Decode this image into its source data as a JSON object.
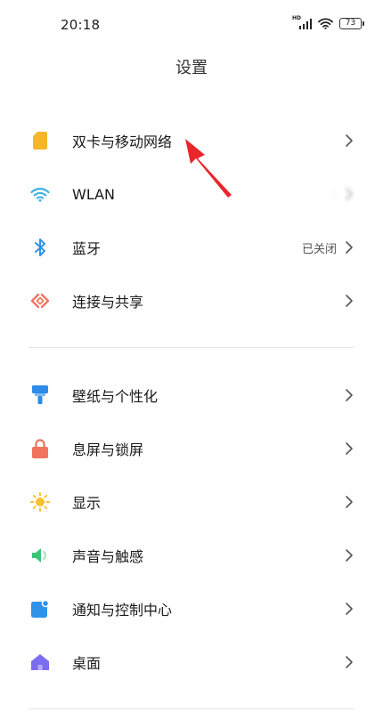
{
  "status_bar": {
    "time": "20:18",
    "hd_label": "HD",
    "battery_level": "73"
  },
  "header": {
    "title": "设置"
  },
  "groups": [
    {
      "items": [
        {
          "label": "双卡与移动网络",
          "icon": "sim-card-icon",
          "icon_color": "#F7B528",
          "value": ""
        },
        {
          "label": "WLAN",
          "icon": "wifi-icon",
          "icon_color": "#3CB3E4",
          "value": "·"
        },
        {
          "label": "蓝牙",
          "icon": "bluetooth-icon",
          "icon_color": "#2E93E8",
          "value": "已关闭"
        },
        {
          "label": "连接与共享",
          "icon": "connection-sharing-icon",
          "icon_color": "#F0735E",
          "value": ""
        }
      ]
    },
    {
      "items": [
        {
          "label": "壁纸与个性化",
          "icon": "paint-roller-icon",
          "icon_color": "#2E8BE8",
          "value": ""
        },
        {
          "label": "息屏与锁屏",
          "icon": "lock-icon",
          "icon_color": "#F0735E",
          "value": ""
        },
        {
          "label": "显示",
          "icon": "sun-icon",
          "icon_color": "#F7C12E",
          "value": ""
        },
        {
          "label": "声音与触感",
          "icon": "speaker-icon",
          "icon_color": "#3CC47B",
          "value": ""
        },
        {
          "label": "通知与控制中心",
          "icon": "notification-icon",
          "icon_color": "#2E93E8",
          "value": ""
        },
        {
          "label": "桌面",
          "icon": "home-icon",
          "icon_color": "#7B6CF0",
          "value": ""
        }
      ]
    }
  ],
  "annotation": {
    "arrow_color": "#E8262B"
  }
}
